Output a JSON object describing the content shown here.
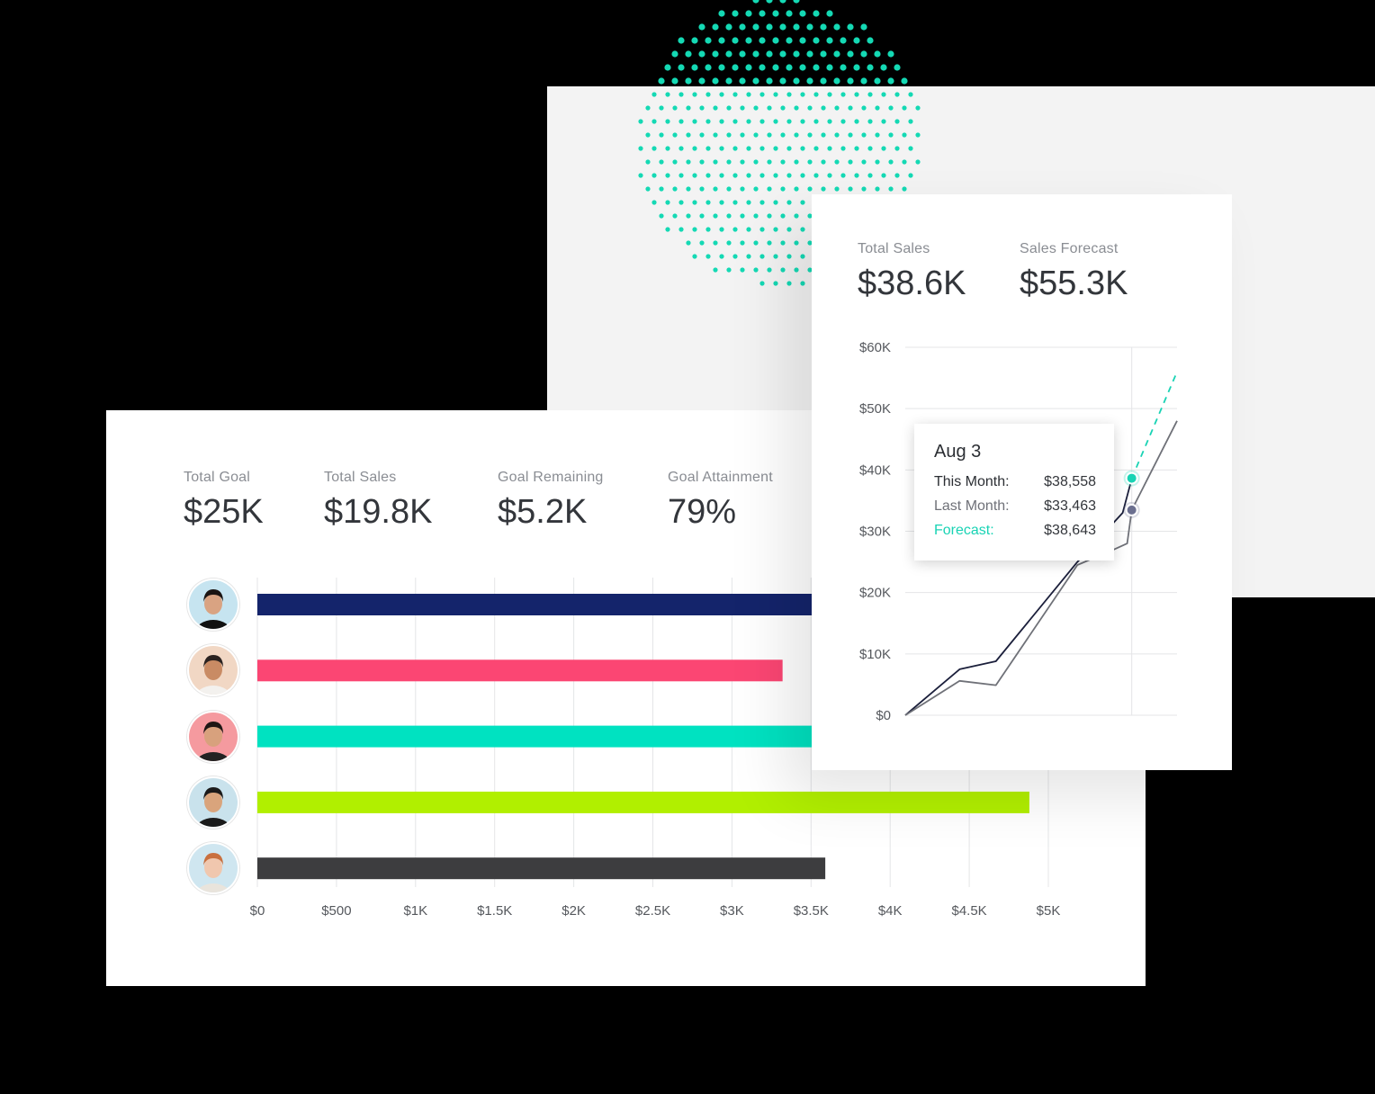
{
  "colors": {
    "bar_colors": [
      "#14246b",
      "#fb4673",
      "#00e2c1",
      "#b1ef00",
      "#3d3d3f"
    ],
    "accent": "#19d3b4",
    "this_month": "#1b1f3b",
    "last_month": "#6f7178",
    "dots": "#14d9b4"
  },
  "goal_panel": {
    "kpis": [
      {
        "label": "Total Goal",
        "value": "$25K"
      },
      {
        "label": "Total Sales",
        "value": "$19.8K"
      },
      {
        "label": "Goal Remaining",
        "value": "$5.2K"
      },
      {
        "label": "Goal Attainment",
        "value": "79%"
      }
    ],
    "avatars": [
      {
        "icon": "avatar-woman-dark-hair-icon",
        "bg": "#c6e4f0"
      },
      {
        "icon": "avatar-man-glasses-icon",
        "bg": "#f1d7c4"
      },
      {
        "icon": "avatar-man-beard-icon",
        "bg": "#f59a9f"
      },
      {
        "icon": "avatar-man-smiling-icon",
        "bg": "#c9e2ec"
      },
      {
        "icon": "avatar-woman-blonde-icon",
        "bg": "#cfe6f0"
      }
    ]
  },
  "forecast_panel": {
    "kpis": [
      {
        "label": "Total Sales",
        "value": "$38.6K"
      },
      {
        "label": "Sales Forecast",
        "value": "$55.3K"
      }
    ],
    "tooltip": {
      "date": "Aug 3",
      "rows": [
        {
          "label": "This Month:",
          "value": "$38,558"
        },
        {
          "label": "Last Month:",
          "value": "$33,463"
        },
        {
          "label": "Forecast:",
          "value": "$38,643"
        }
      ]
    }
  },
  "chart_data": [
    {
      "type": "bar",
      "orientation": "horizontal",
      "categories": [
        "",
        "",
        "",
        "",
        ""
      ],
      "values": [
        4430,
        3320,
        4800,
        4880,
        3590
      ],
      "xticks": [
        "$0",
        "$500",
        "$1K",
        "$1.5K",
        "$2K",
        "$2.5K",
        "$3K",
        "$3.5K",
        "$4K",
        "$4.5K",
        "$5K"
      ],
      "xlim": [
        0,
        5000
      ],
      "grid": true
    },
    {
      "type": "line",
      "yticks": [
        "$0",
        "$10K",
        "$20K",
        "$30K",
        "$40K",
        "$50K",
        "$60K"
      ],
      "ylim": [
        0,
        60000
      ],
      "xlim": [
        0,
        30
      ],
      "grid": true,
      "series": [
        {
          "key": "this_month",
          "style": "solid",
          "x": [
            0,
            6,
            10,
            19,
            24,
            25
          ],
          "y": [
            0,
            7500,
            8800,
            25000,
            33000,
            38558
          ]
        },
        {
          "key": "last_month",
          "style": "solid",
          "x": [
            0,
            6,
            10,
            19,
            23,
            24.5,
            25,
            30
          ],
          "y": [
            0,
            5600,
            4900,
            24500,
            27000,
            28000,
            33463,
            48000
          ]
        },
        {
          "key": "forecast",
          "style": "dashed",
          "x": [
            25,
            30
          ],
          "y": [
            38643,
            56000
          ]
        }
      ],
      "highlight_x": 25
    }
  ]
}
